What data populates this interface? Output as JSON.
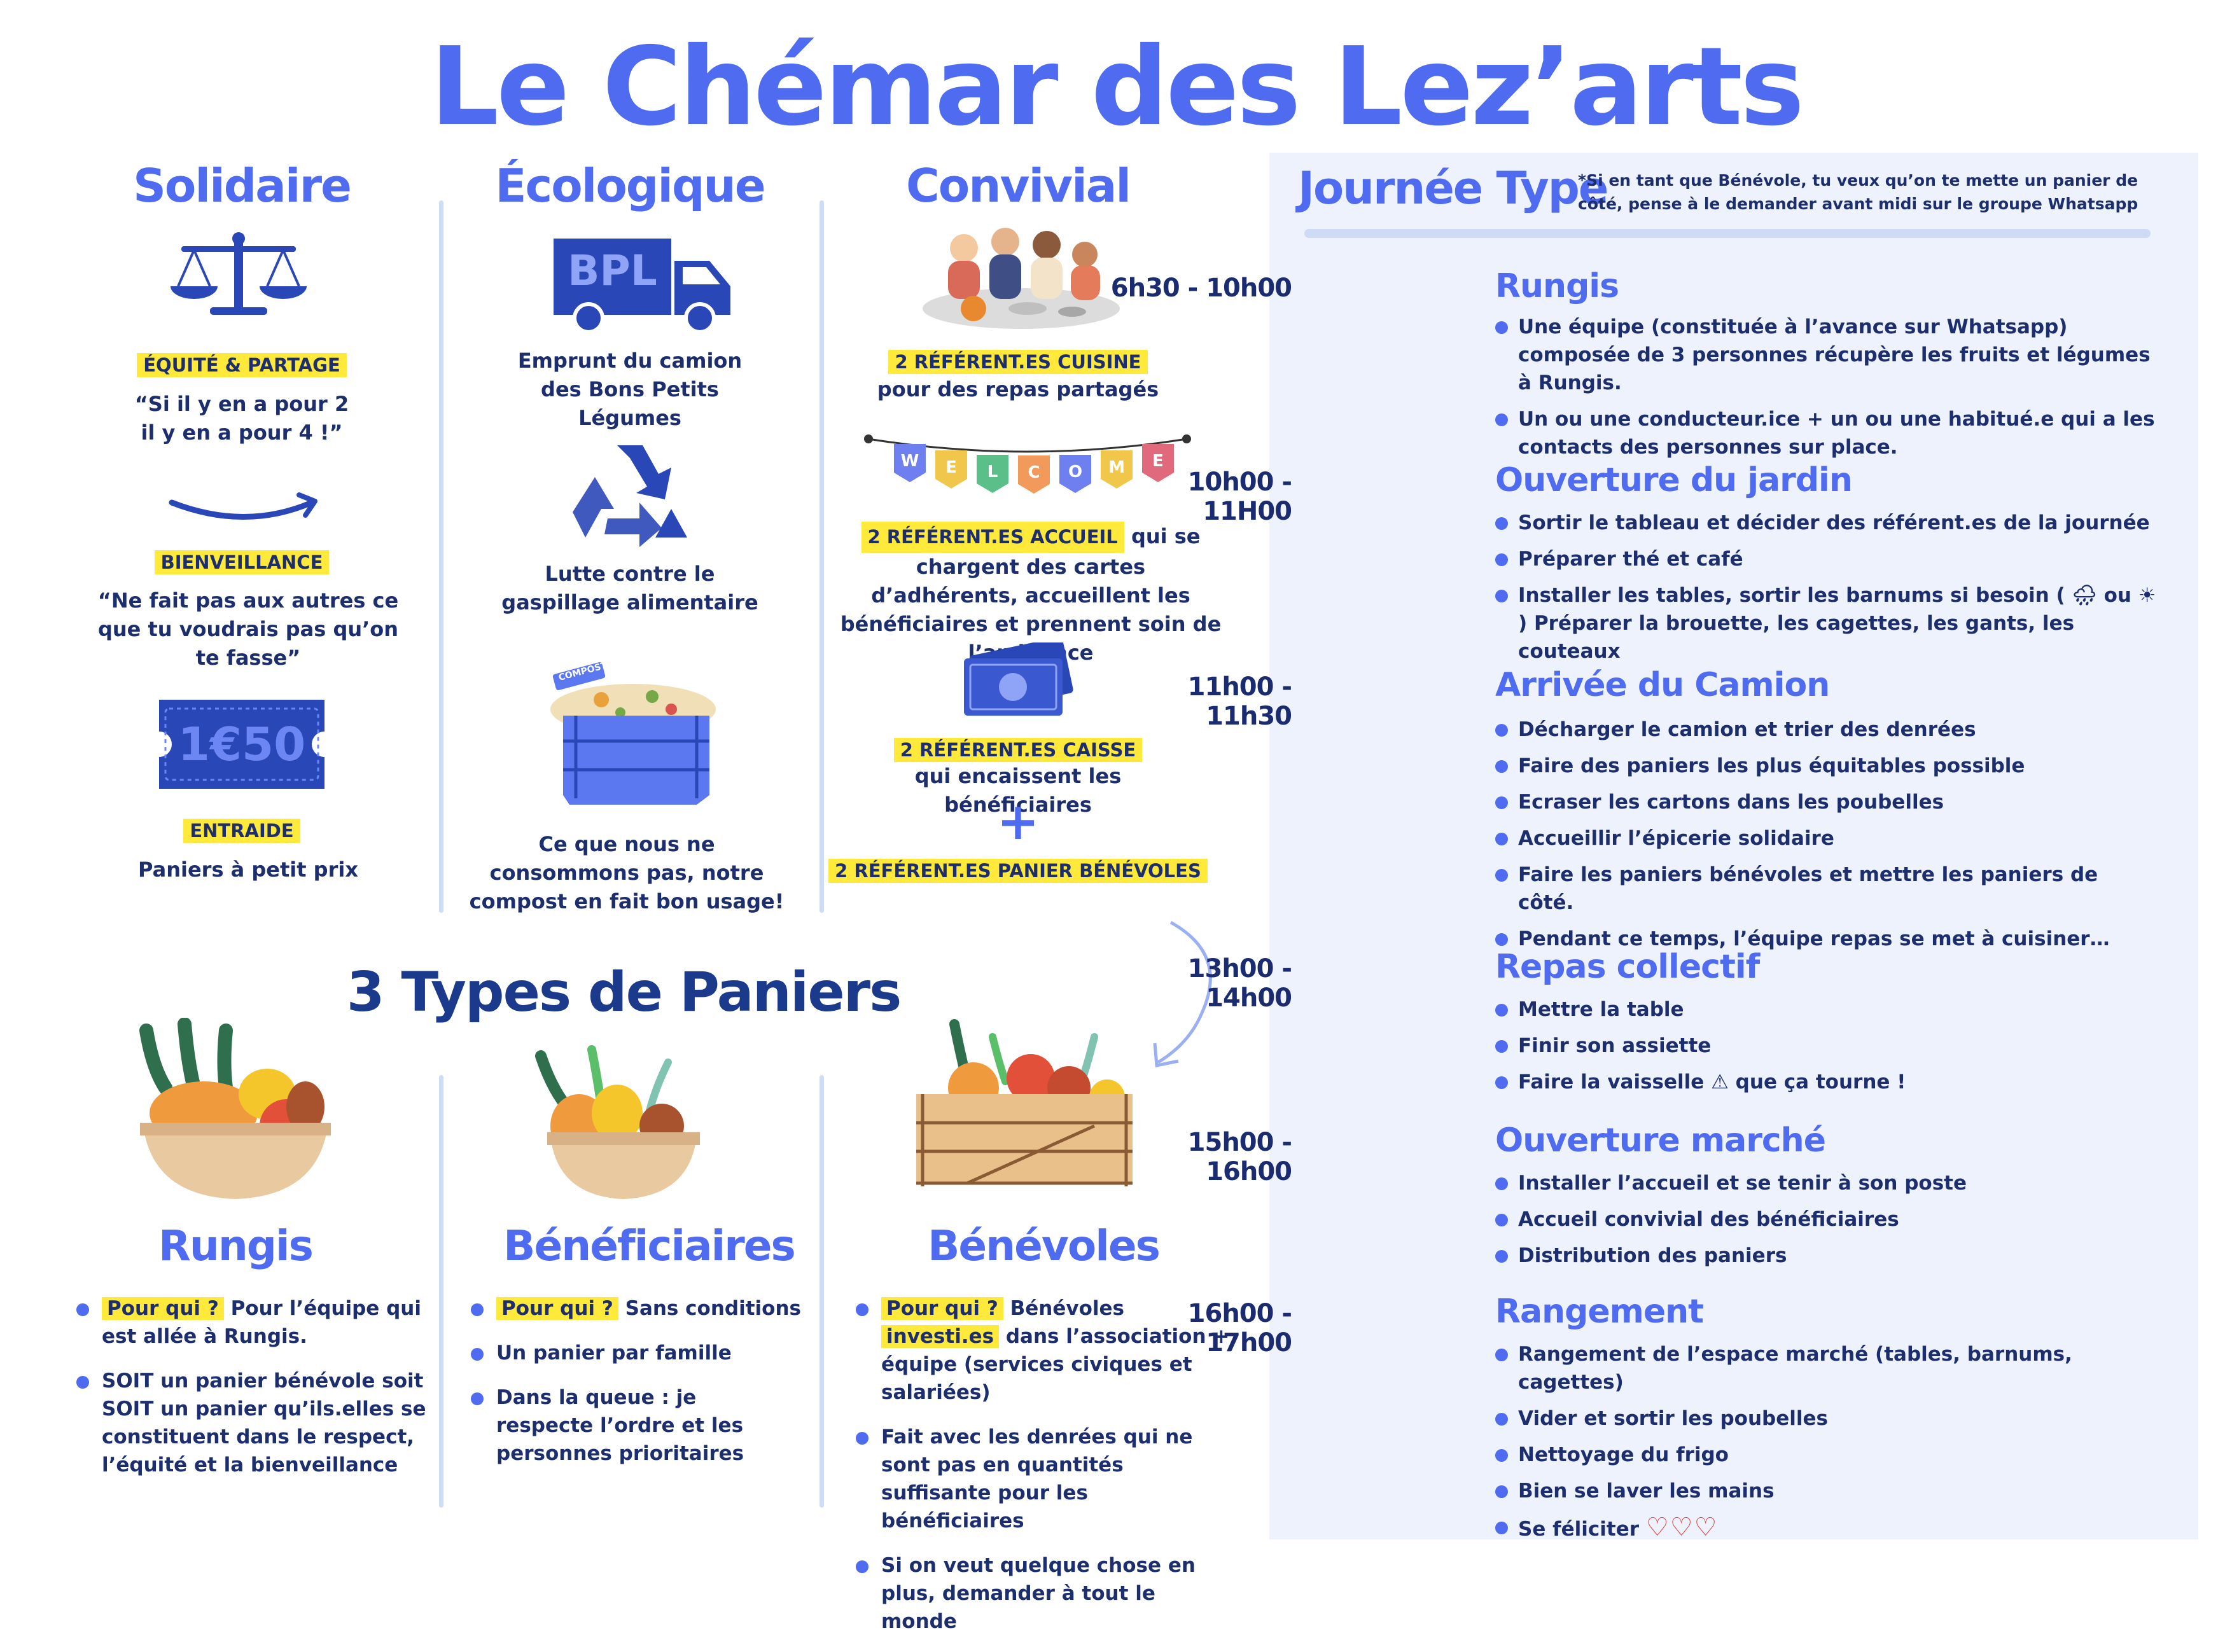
{
  "title": "Le Chémar des Lez’arts",
  "columns": {
    "solidaire": {
      "title": "Solidaire",
      "tag1": "ÉQUITÉ & PARTAGE",
      "text1": "“Si il y en a pour 2 il y en a pour 4 !”",
      "tag2": "BIENVEILLANCE",
      "text2": "“Ne fait pas aux autres ce que tu voudrais pas qu’on te fasse”",
      "ticket": "1€50",
      "tag3": "ENTRAIDE",
      "text3": "Paniers à petit prix"
    },
    "ecologique": {
      "title": "Écologique",
      "truck_label": "BPL",
      "text1": "Emprunt du camion des Bons Petits Légumes",
      "text2": "Lutte contre le gaspillage alimentaire",
      "compost_label": "COMPOST",
      "text3": "Ce que nous ne consommons pas, notre compost en fait bon usage!"
    },
    "convivial": {
      "title": "Convivial",
      "tag1": "2 RÉFÉRENT.ES CUISINE",
      "text1": "pour des repas partagés",
      "banner": [
        "W",
        "E",
        "L",
        "C",
        "O",
        "M",
        "E"
      ],
      "tag2": "2 RÉFÉRENT.ES ACCUEIL",
      "text2a": " qui se",
      "text2b": "chargent des cartes d’adhérents, accueillent les  bénéficiaires et prennent soin de l’ambiance",
      "tag3": "2 RÉFÉRENT.ES CAISSE",
      "text3": "qui encaissent les bénéficiaires",
      "plus": "+",
      "tag4": "2 RÉFÉRENT.ES PANIER BÉNÉVOLES"
    }
  },
  "paniers": {
    "title": "3 Types de Paniers",
    "rungis": {
      "title": "Rungis",
      "items": [
        {
          "hl": "Pour qui ?",
          "text": " Pour l’équipe qui est allée à Rungis."
        },
        {
          "hl": "",
          "text": "SOIT un panier bénévole soit SOIT un panier qu’ils.elles se constituent dans le respect, l’équité et la bienveillance"
        }
      ]
    },
    "beneficiaires": {
      "title": "Bénéficiaires",
      "items": [
        {
          "hl": "Pour qui ?",
          "text": " Sans conditions"
        },
        {
          "hl": "",
          "text": "Un panier par famille"
        },
        {
          "hl": "",
          "text": "Dans la queue : je respecte l’ordre et les personnes prioritaires"
        }
      ]
    },
    "benevoles": {
      "title": "Bénévoles",
      "item1_hl": "Pour qui ?",
      "item1_text": " Bénévoles ",
      "item1_hl2": "investi.es",
      "item1_text2": " dans l’association + équipe (services civiques et salariées)",
      "item2": "Fait avec les denrées qui ne sont pas en quantités suffisante pour les bénéficiaires",
      "item3": "Si on veut quelque chose en plus, demander à tout le monde"
    }
  },
  "journee": {
    "title": "Journée Type",
    "note": "*Si en tant que Bénévole, tu veux qu’on te mette un panier de côté, pense à le demander avant midi sur le groupe Whatsapp",
    "slots": [
      {
        "time": "6h30 - 10h00",
        "head": "Rungis",
        "items": [
          "Une équipe (constituée à l’avance sur Whatsapp) composée de 3 personnes récupère les fruits et légumes à Rungis.",
          "Un ou une conducteur.ice + un ou une habitué.e qui a les contacts des personnes sur place."
        ]
      },
      {
        "time": "10h00 - 11H00",
        "head": "Ouverture du jardin",
        "items": [
          "Sortir le tableau et décider des référent.es de la journée",
          "Préparer thé et café",
          "Installer les tables, sortir les barnums si besoin ( 🌧 ou ☀ ) Préparer la brouette, les cagettes, les gants, les couteaux"
        ]
      },
      {
        "time": "11h00 - 11h30",
        "head": "Arrivée du Camion",
        "items": [
          "Décharger le camion et trier des denrées",
          "Faire des paniers les plus équitables possible",
          "Ecraser les cartons dans les poubelles",
          "Accueillir l’épicerie solidaire",
          "Faire les paniers bénévoles et mettre les paniers de côté.",
          "Pendant ce temps, l’équipe repas se met à cuisiner…"
        ]
      },
      {
        "time": "13h00 - 14h00",
        "head": "Repas collectif",
        "items": [
          "Mettre la table",
          "Finir son assiette",
          "Faire la vaisselle ⚠ que ça tourne !"
        ]
      },
      {
        "time": "15h00 - 16h00",
        "head": "Ouverture marché",
        "items": [
          "Installer l’accueil et se tenir à son poste",
          "Accueil convivial des bénéficiaires",
          "Distribution des paniers"
        ]
      },
      {
        "time": "16h00 - 17h00",
        "head": "Rangement",
        "items": [
          "Rangement de l’espace marché (tables, barnums, cagettes)",
          "Vider et sortir les poubelles",
          "Nettoyage du frigo",
          "Bien se laver les mains",
          "Se féliciter"
        ]
      }
    ],
    "hearts": "♡♡♡"
  },
  "colors": {
    "accent": "#4f6cf0",
    "navy": "#1c2e6e",
    "highlight": "#ffe93a",
    "panel": "#eef2fc"
  }
}
